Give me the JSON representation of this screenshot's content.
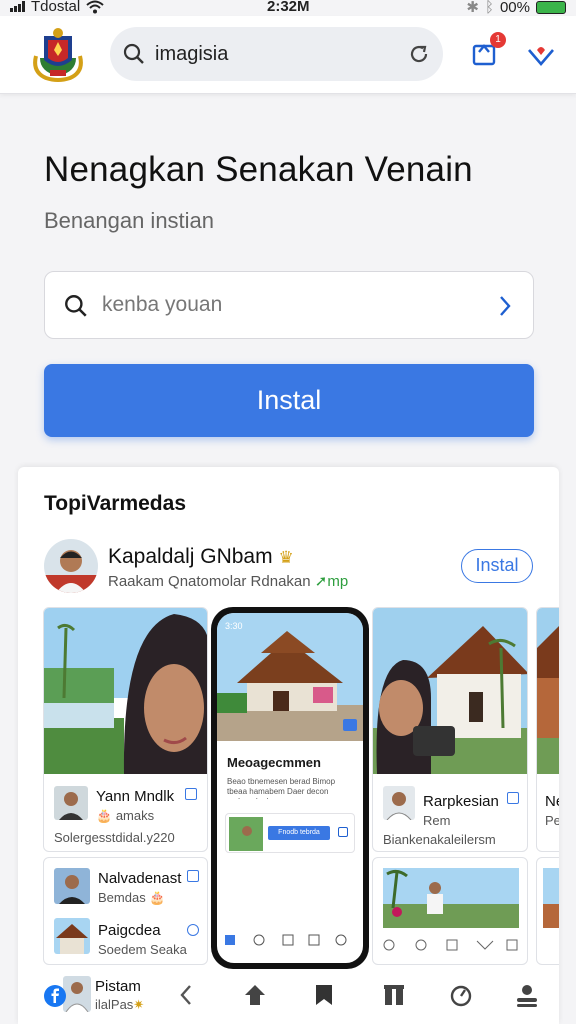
{
  "status_bar": {
    "carrier": "Tdostal",
    "time": "2:32M",
    "battery": "00%"
  },
  "top_search": {
    "query": "imagisia"
  },
  "notifications": {
    "count": "1"
  },
  "hero": {
    "title": "Nenagkan Senakan Venain",
    "subtitle": "Benangan instian",
    "search_placeholder": "kenba youan",
    "install_label": "Instal"
  },
  "section": {
    "title": "TopiVarmedas",
    "profile": {
      "name": "Kapaldalj GNbam",
      "subtitle": "Raakam Qnatomolar Rdnakan",
      "tag": "mp",
      "install_label": "Instal"
    },
    "cards": [
      {
        "title": "Yann Mndlk",
        "sub": "amaks",
        "footer": "Solergesstdidal.y220"
      },
      {
        "title": "Rarpkesian",
        "sub": "Rem",
        "footer": "Biankenakaleilersm"
      },
      {
        "title": "Ne",
        "sub": "Pe"
      }
    ],
    "phone": {
      "time": "3:30",
      "heading": "Meoagecmmen",
      "text": "Beao tbnemesen berad Bimop tbeaa hamabem Daer decon cedem dpalm",
      "link": "Fnodb tebrda"
    },
    "list_items": [
      {
        "title": "Nalvadenast",
        "sub": "Bemdas"
      },
      {
        "title": "Paigcdea",
        "sub": "Soedem Seaka"
      },
      {
        "title": "Pistam",
        "sub": "ilalPas"
      }
    ]
  },
  "colors": {
    "accent": "#3a78e3",
    "badge": "#e53935",
    "card_bg": "#ffffff",
    "page_bg": "#f4f4f6"
  },
  "icons": [
    "signal-icon",
    "wifi-icon",
    "bluetooth-icon",
    "battery-icon",
    "search-icon",
    "refresh-icon",
    "notification-icon",
    "heart-icon",
    "chevron-right-icon",
    "back-icon",
    "home-icon",
    "bookmark-icon",
    "columns-icon",
    "timer-icon",
    "people-icon",
    "facebook-icon"
  ]
}
